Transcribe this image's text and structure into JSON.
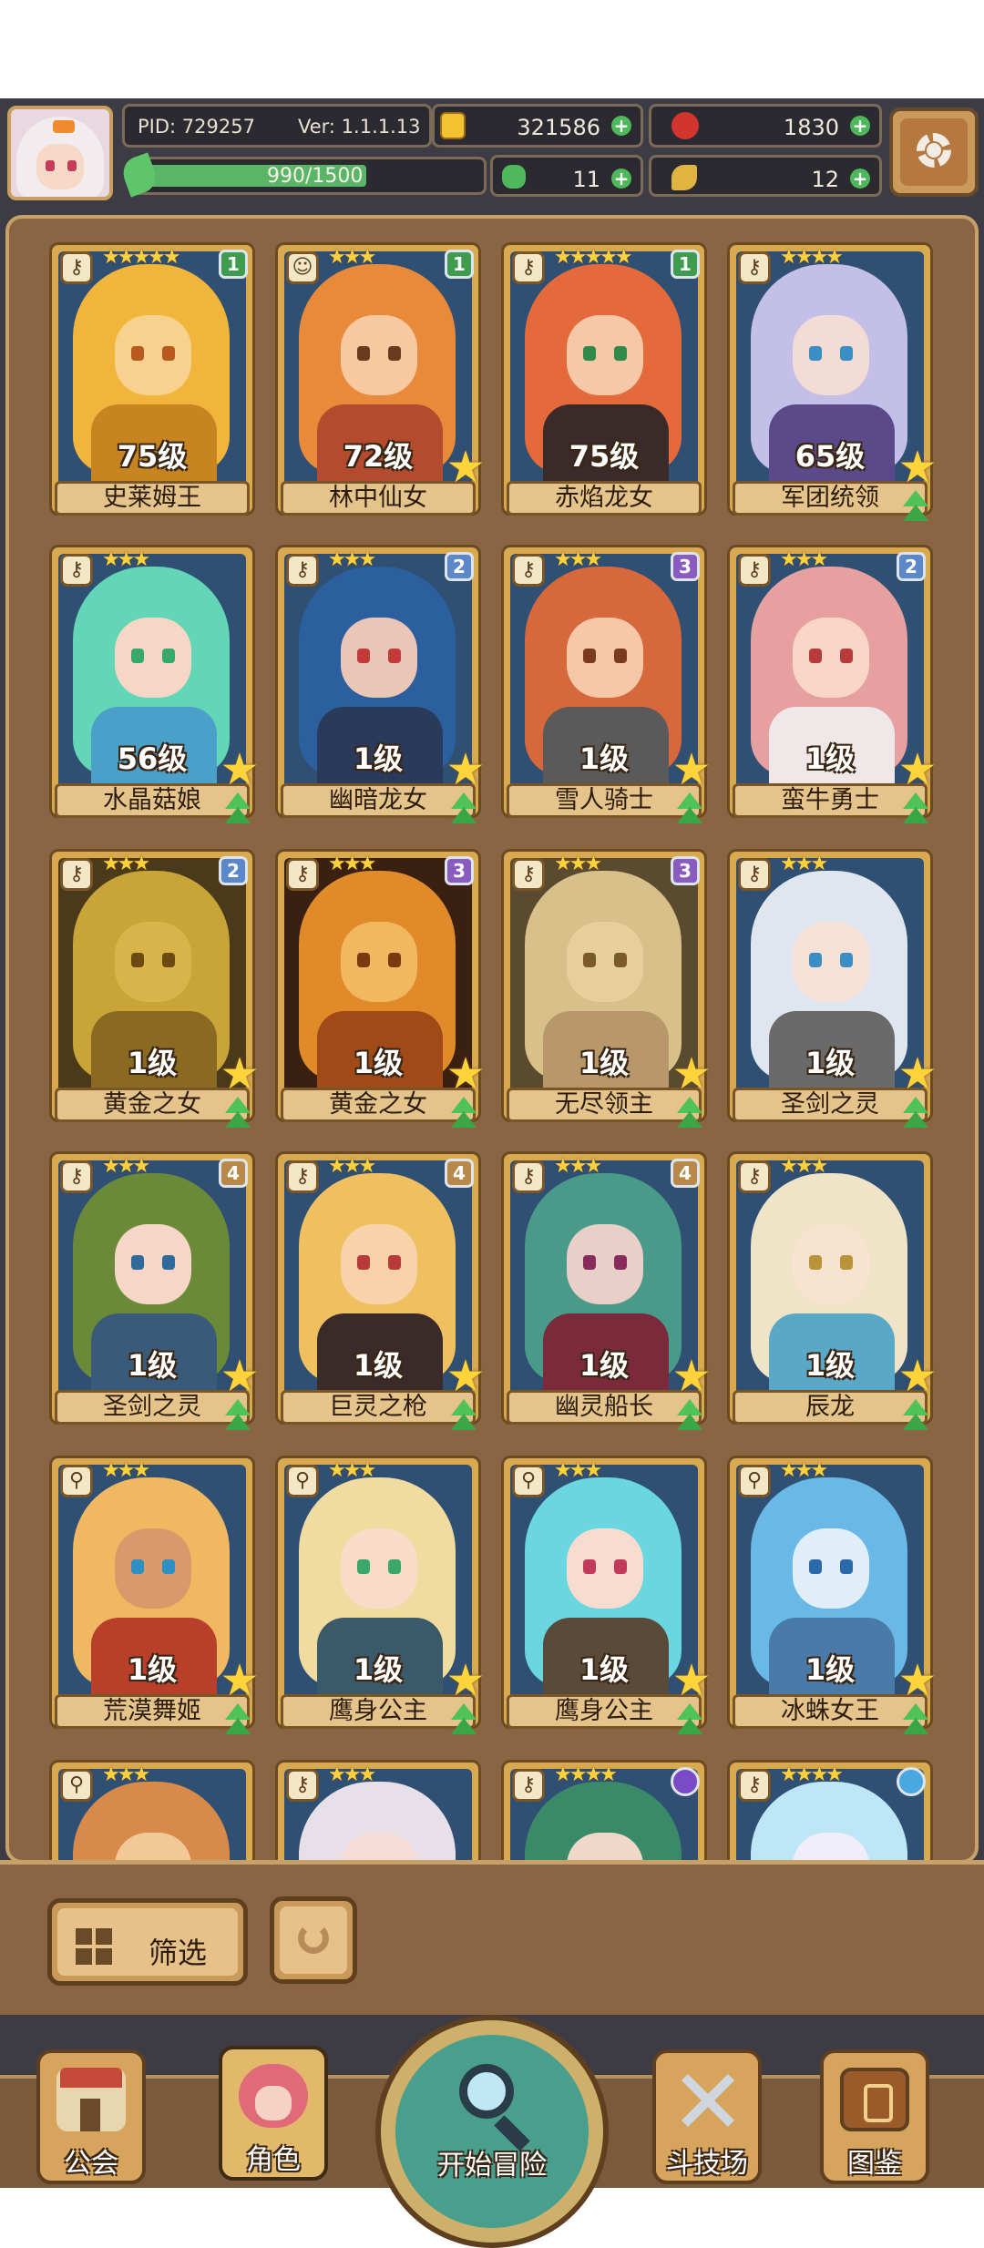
{
  "player": {
    "pid": "PID: 729257",
    "version": "Ver: 1.1.1.13",
    "gold": "321586",
    "apples": "1830",
    "stamina": "990/1500",
    "stamina_fraction": 0.66,
    "clovers": "11",
    "keys": "12"
  },
  "icons": {
    "avatar": "avatar-girl-white-hair",
    "gold": "gold-coin-icon",
    "apple": "red-apple-icon",
    "stamina": "green-leaf-icon",
    "clover": "clover-icon",
    "key": "key-icon",
    "plus": "plus-icon",
    "settings": "gear-icon"
  },
  "cards": [
    {
      "name": "史莱姆王",
      "level": "75级",
      "stars": "★★★★★",
      "badge": "1",
      "badge_color": "#3f9b4e",
      "hair": "#f0b53a",
      "skin": "#f7d28e",
      "eye": "#b85a1f",
      "body": "#c78420",
      "bg": "#2f4f73",
      "show_star": false,
      "show_up": false,
      "weapon": "⚷"
    },
    {
      "name": "林中仙女",
      "level": "72级",
      "stars": "★★★",
      "badge": "1",
      "badge_color": "#3f9b4e",
      "hair": "#e98a3a",
      "skin": "#f8c9a0",
      "eye": "#6b3a1f",
      "body": "#b44a2e",
      "bg": "#2f4f73",
      "show_star": true,
      "show_up": false,
      "weapon": "☺"
    },
    {
      "name": "赤焰龙女",
      "level": "75级",
      "stars": "★★★★★",
      "badge": "1",
      "badge_color": "#3f9b4e",
      "hair": "#e46a3c",
      "skin": "#f6c8a8",
      "eye": "#2f8a4a",
      "body": "#3a2a2a",
      "bg": "#2f4f73",
      "show_star": false,
      "show_up": false,
      "weapon": "⚷"
    },
    {
      "name": "军团统领",
      "level": "65级",
      "stars": "★★★★",
      "badge": "",
      "badge_color": "",
      "hair": "#c3bfe6",
      "skin": "#f4dcd6",
      "eye": "#3a8ec4",
      "body": "#5a4a8a",
      "bg": "#2f4f73",
      "show_star": true,
      "show_up": true,
      "weapon": "⚷"
    },
    {
      "name": "水晶菇娘",
      "level": "56级",
      "stars": "★★★",
      "badge": "",
      "badge_color": "",
      "hair": "#63d6b8",
      "skin": "#f6d6c6",
      "eye": "#3aa86a",
      "body": "#4aa0c8",
      "bg": "#2f4f73",
      "show_star": true,
      "show_up": true,
      "weapon": "⚷"
    },
    {
      "name": "幽暗龙女",
      "level": "1级",
      "stars": "★★★",
      "badge": "2",
      "badge_color": "#5c87c9",
      "hair": "#2b5f9e",
      "skin": "#eac6b8",
      "eye": "#c23a3a",
      "body": "#2a3a5a",
      "bg": "#2f4f73",
      "show_star": true,
      "show_up": true,
      "weapon": "⚷"
    },
    {
      "name": "雪人骑士",
      "level": "1级",
      "stars": "★★★",
      "badge": "3",
      "badge_color": "#8a5cc0",
      "hair": "#d6683c",
      "skin": "#f6c8a8",
      "eye": "#7a3a1f",
      "body": "#5a5a5a",
      "bg": "#2f4f73",
      "show_star": true,
      "show_up": true,
      "weapon": "⚷"
    },
    {
      "name": "蛮牛勇士",
      "level": "1级",
      "stars": "★★★",
      "badge": "2",
      "badge_color": "#5c87c9",
      "hair": "#e6a0a0",
      "skin": "#f8d6c8",
      "eye": "#b83a3a",
      "body": "#f0e8e8",
      "bg": "#2f4f73",
      "show_star": true,
      "show_up": true,
      "weapon": "⚷"
    },
    {
      "name": "黄金之女",
      "level": "1级",
      "stars": "★★★",
      "badge": "2",
      "badge_color": "#5c87c9",
      "hair": "#c9a438",
      "skin": "#d8b44a",
      "eye": "#6a4a10",
      "body": "#8a6a20",
      "bg": "#4a3a1a",
      "show_star": true,
      "show_up": true,
      "weapon": "⚷"
    },
    {
      "name": "黄金之女",
      "level": "1级",
      "stars": "★★★",
      "badge": "3",
      "badge_color": "#8a5cc0",
      "hair": "#e08a2a",
      "skin": "#f2b860",
      "eye": "#7a3a10",
      "body": "#a04a18",
      "bg": "#3a2010",
      "show_star": true,
      "show_up": true,
      "weapon": "⚷"
    },
    {
      "name": "无尽领主",
      "level": "1级",
      "stars": "★★★",
      "badge": "3",
      "badge_color": "#8a5cc0",
      "hair": "#d8c08a",
      "skin": "#e6cf9a",
      "eye": "#7a5a2a",
      "body": "#b8986a",
      "bg": "#5a4a30",
      "show_star": true,
      "show_up": true,
      "weapon": "⚷"
    },
    {
      "name": "圣剑之灵",
      "level": "1级",
      "stars": "★★★",
      "badge": "",
      "badge_color": "",
      "hair": "#dfe6f0",
      "skin": "#f8e2d8",
      "eye": "#3a8ec4",
      "body": "#6a6a6a",
      "bg": "#2f4f73",
      "show_star": true,
      "show_up": true,
      "weapon": "⚷"
    },
    {
      "name": "圣剑之灵",
      "level": "1级",
      "stars": "★★★",
      "badge": "4",
      "badge_color": "#b8894a",
      "hair": "#6a8a3a",
      "skin": "#f6d6c6",
      "eye": "#2f6a9a",
      "body": "#3a5a7a",
      "bg": "#2f4f73",
      "show_star": true,
      "show_up": true,
      "weapon": "⚷"
    },
    {
      "name": "巨灵之枪",
      "level": "1级",
      "stars": "★★★",
      "badge": "4",
      "badge_color": "#b8894a",
      "hair": "#f0c060",
      "skin": "#f8d2a8",
      "eye": "#b83a3a",
      "body": "#3a2a2a",
      "bg": "#2f4f73",
      "show_star": true,
      "show_up": true,
      "weapon": "⚷"
    },
    {
      "name": "幽灵船长",
      "level": "1级",
      "stars": "★★★",
      "badge": "4",
      "badge_color": "#b8894a",
      "hair": "#4a9a8a",
      "skin": "#e8d0c8",
      "eye": "#8a2a5a",
      "body": "#7a2a3a",
      "bg": "#2f4f73",
      "show_star": true,
      "show_up": true,
      "weapon": "⚷"
    },
    {
      "name": "辰龙",
      "level": "1级",
      "stars": "★★★",
      "badge": "",
      "badge_color": "",
      "hair": "#efe4c8",
      "skin": "#f8e2d0",
      "eye": "#b8943a",
      "body": "#5aa8c8",
      "bg": "#2f4f73",
      "show_star": true,
      "show_up": true,
      "weapon": "⚷"
    },
    {
      "name": "荒漠舞姬",
      "level": "1级",
      "stars": "★★★",
      "badge": "",
      "badge_color": "",
      "hair": "#f0b860",
      "skin": "#d89a6a",
      "eye": "#2f8ec4",
      "body": "#b8402a",
      "bg": "#2f4f73",
      "show_star": true,
      "show_up": true,
      "weapon": "⚲"
    },
    {
      "name": "鹰身公主",
      "level": "1级",
      "stars": "★★★",
      "badge": "",
      "badge_color": "",
      "hair": "#f0dca0",
      "skin": "#f8dcc8",
      "eye": "#3aa86a",
      "body": "#3a5a6a",
      "bg": "#2f4f73",
      "show_star": true,
      "show_up": true,
      "weapon": "⚲"
    },
    {
      "name": "鹰身公主",
      "level": "1级",
      "stars": "★★★",
      "badge": "",
      "badge_color": "",
      "hair": "#6ad6e0",
      "skin": "#f8dcd0",
      "eye": "#c23a5a",
      "body": "#5a4a3a",
      "bg": "#2f4f73",
      "show_star": true,
      "show_up": true,
      "weapon": "⚲"
    },
    {
      "name": "冰蛛女王",
      "level": "1级",
      "stars": "★★★",
      "badge": "",
      "badge_color": "",
      "hair": "#6ab8e6",
      "skin": "#e0eef8",
      "eye": "#2a6aa8",
      "body": "#4a7aa8",
      "bg": "#2f4f73",
      "show_star": true,
      "show_up": true,
      "weapon": "⚲"
    },
    {
      "name": "",
      "level": "",
      "stars": "★★★",
      "badge": "",
      "badge_color": "",
      "hair": "#d88a4a",
      "skin": "#f2c898",
      "eye": "#6a3a1a",
      "body": "#a0602a",
      "bg": "#2f4f73",
      "show_star": false,
      "show_up": false,
      "weapon": "⚲"
    },
    {
      "name": "",
      "level": "",
      "stars": "★★★",
      "badge": "",
      "badge_color": "",
      "hair": "#e8e0e8",
      "skin": "#f6dcd6",
      "eye": "#6a3a8a",
      "body": "#3a2a4a",
      "bg": "#2f4f73",
      "show_star": false,
      "show_up": false,
      "weapon": "⚷"
    },
    {
      "name": "",
      "level": "",
      "stars": "★★★★",
      "badge": "",
      "badge_color": "#7a4ac8",
      "hair": "#3a8a6a",
      "skin": "#f0d8c8",
      "eye": "#c8a03a",
      "body": "#2a5a4a",
      "bg": "#2f4f73",
      "show_star": false,
      "show_up": false,
      "weapon": "⚷"
    },
    {
      "name": "",
      "level": "",
      "stars": "★★★★",
      "badge": "",
      "badge_color": "#4aa8e0",
      "hair": "#bde6f6",
      "skin": "#f0eef8",
      "eye": "#2a6aa8",
      "body": "#4a7aa8",
      "bg": "#2f4f73",
      "show_star": false,
      "show_up": false,
      "weapon": "⚷"
    }
  ],
  "filter": {
    "label": "筛选"
  },
  "nav": {
    "guild": "公会",
    "character": "角色",
    "adventure": "开始冒险",
    "arena": "斗技场",
    "codex": "图鉴"
  },
  "colors": {
    "panel": "#8a6543",
    "frame_gold": "#d9a94f",
    "dark_bar": "#3d3c45"
  }
}
